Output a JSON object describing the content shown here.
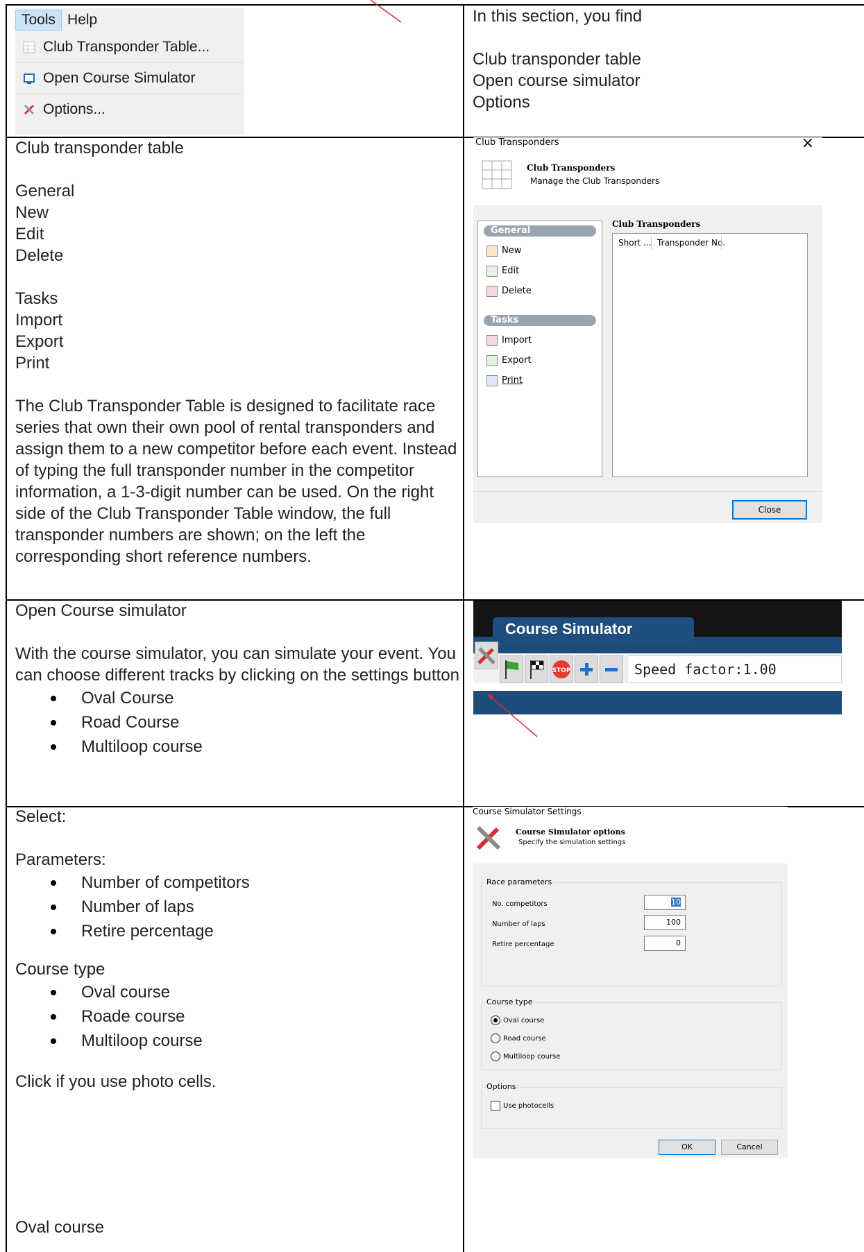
{
  "row1": {
    "menu": {
      "bar": [
        "Tools",
        "Help"
      ],
      "items": [
        "Club Transponder Table...",
        "Open Course Simulator",
        "Options..."
      ]
    },
    "right_lines": [
      "In this section, you find",
      "",
      "Club transponder table",
      "Open course simulator",
      "Options"
    ]
  },
  "row2": {
    "lines": [
      "Club transponder table",
      "",
      "General",
      "New",
      "Edit",
      "Delete",
      "",
      "Tasks",
      "Import",
      "Export",
      "Print"
    ],
    "paragraph": "The Club Transponder Table is designed to facilitate race series that own their own pool of rental transponders and assign them to a new competitor before each event. Instead of typing the full transponder number in the competitor information, a 1-3-digit number can be used. On the right side of the Club Transponder Table window, the full transponder numbers are shown; on the left the corresponding short reference numbers.",
    "dialog": {
      "window_title": "Club Transponders",
      "close_glyph": "×",
      "header_title": "Club Transponders",
      "header_sub": "Manage the Club Transponders",
      "general_label": "General",
      "general_items": [
        "New",
        "Edit",
        "Delete"
      ],
      "tasks_label": "Tasks",
      "tasks_items": [
        "Import",
        "Export",
        "Print"
      ],
      "list_title": "Club Transponders",
      "columns": [
        "Short ...",
        "Transponder No."
      ],
      "close_button": "Close"
    }
  },
  "row3": {
    "heading": "Open Course simulator",
    "text": "With the course simulator, you can simulate your event. You can choose different tracks by clicking on the settings button",
    "bullets": [
      "Oval Course",
      "Road Course",
      "Multiloop course"
    ],
    "sim": {
      "tab": "Course Simulator",
      "speed": "Speed factor:1.00",
      "stop": "STOP"
    }
  },
  "row4": {
    "select": "Select:",
    "params_heading": "Parameters:",
    "params": [
      "Number of competitors",
      "Number of laps",
      "Retire percentage"
    ],
    "course_heading": "Course type",
    "courses": [
      "Oval course",
      "Roade course",
      "Multiloop course"
    ],
    "photo": "Click if you use photo cells.",
    "oval": "Oval course",
    "dialog": {
      "window_title": "Course Simulator Settings",
      "header_title": "Course Simulator options",
      "header_sub": "Specify the simulation settings",
      "race_group": "Race parameters",
      "fields": [
        {
          "label": "No. competitors",
          "value": "10"
        },
        {
          "label": "Number of laps",
          "value": "100"
        },
        {
          "label": "Retire percentage",
          "value": "0"
        }
      ],
      "course_group": "Course type",
      "radios": [
        "Oval course",
        "Road course",
        "Multiloop course"
      ],
      "selected_radio": "Oval course",
      "options_group": "Options",
      "photocells": "Use photocells",
      "ok": "OK",
      "cancel": "Cancel"
    }
  }
}
